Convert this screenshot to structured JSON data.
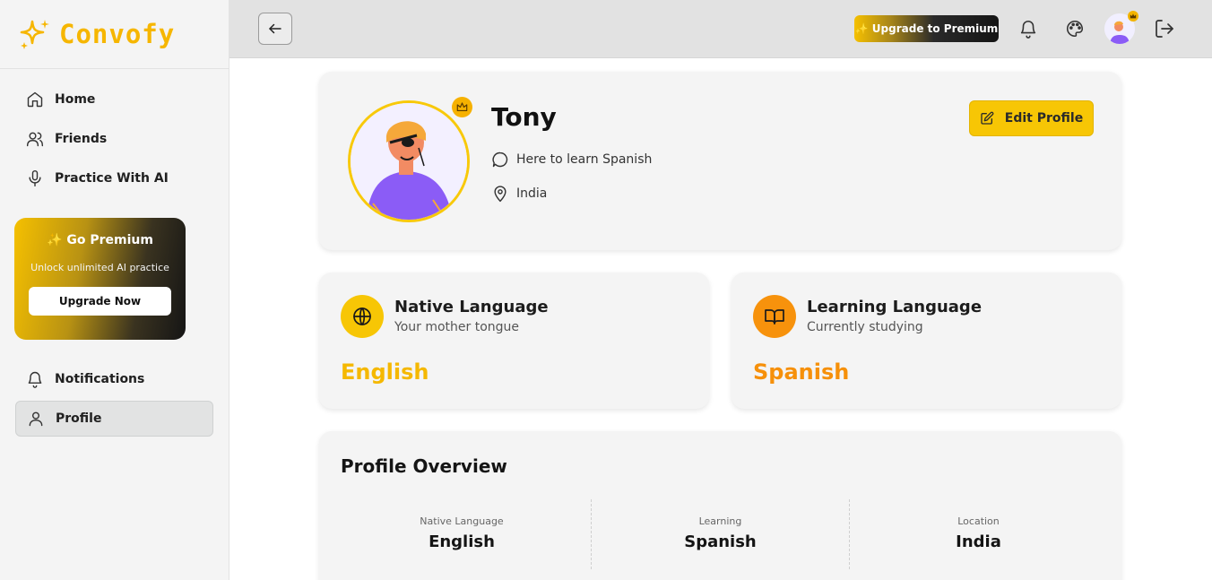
{
  "brand": {
    "name": "Convofy"
  },
  "sidebar": {
    "items": [
      {
        "label": "Home",
        "icon": "home-icon"
      },
      {
        "label": "Friends",
        "icon": "users-icon"
      },
      {
        "label": "Practice With AI",
        "icon": "mic-icon"
      }
    ],
    "premium": {
      "title": "✨ Go Premium",
      "subtitle": "Unlock unlimited AI practice",
      "button": "Upgrade Now"
    },
    "bottom_items": [
      {
        "label": "Notifications",
        "icon": "bell-icon"
      },
      {
        "label": "Profile",
        "icon": "user-icon",
        "active": true
      }
    ]
  },
  "topbar": {
    "upgrade_label": "✨ Upgrade to Premium",
    "icons": [
      "back-arrow-icon",
      "bell-icon",
      "palette-icon",
      "avatar",
      "logout-icon"
    ]
  },
  "profile": {
    "name": "Tony",
    "bio": "Here to learn Spanish",
    "location": "India",
    "edit_label": "Edit Profile"
  },
  "native_language": {
    "title": "Native Language",
    "subtitle": "Your mother tongue",
    "value": "English",
    "color": "#f5b800"
  },
  "learning_language": {
    "title": "Learning Language",
    "subtitle": "Currently studying",
    "value": "Spanish",
    "color": "#f6900a"
  },
  "overview": {
    "title": "Profile Overview",
    "stats": [
      {
        "label": "Native Language",
        "value": "English"
      },
      {
        "label": "Learning",
        "value": "Spanish"
      },
      {
        "label": "Location",
        "value": "India"
      }
    ]
  },
  "colors": {
    "accent": "#f6b600",
    "sidebar_bg": "#f4f4f4",
    "topbar_bg": "#e2e2e2",
    "card_bg": "#f4f4f4"
  }
}
